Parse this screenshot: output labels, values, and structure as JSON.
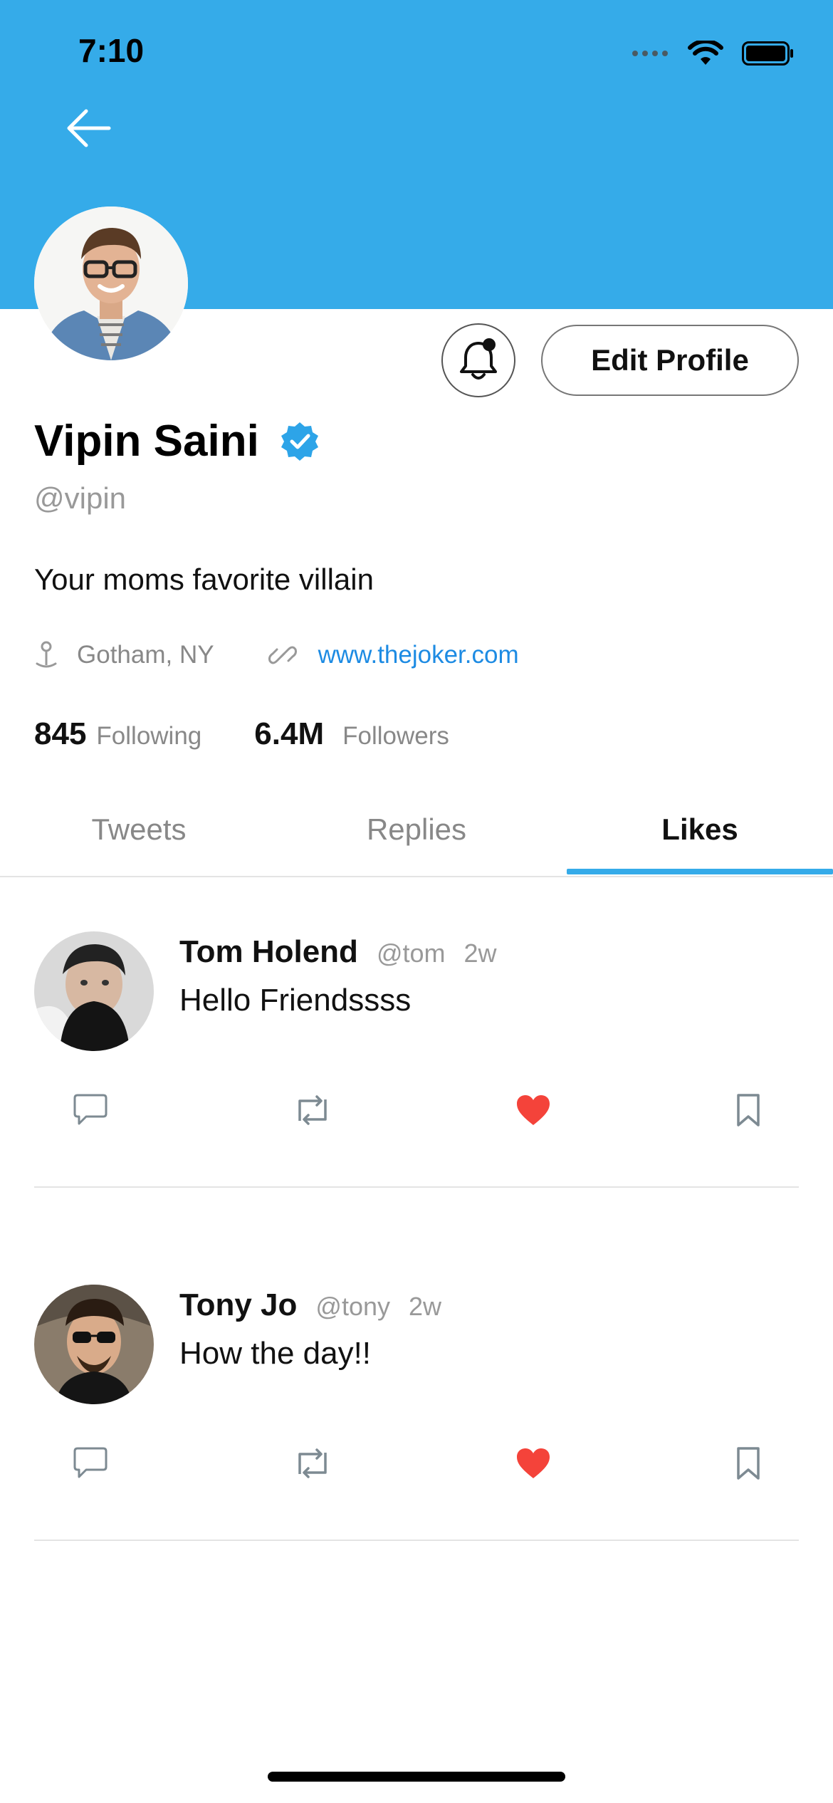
{
  "status_bar": {
    "time": "7:10"
  },
  "profile": {
    "name": "Vipin Saini",
    "handle": "@vipin",
    "bio": "Your moms favorite villain",
    "location": "Gotham, NY",
    "website": "www.thejoker.com",
    "following_count": "845",
    "following_label": "Following",
    "followers_count": "6.4M",
    "followers_label": "Followers",
    "edit_label": "Edit Profile"
  },
  "tabs": [
    {
      "label": "Tweets",
      "active": false
    },
    {
      "label": "Replies",
      "active": false
    },
    {
      "label": "Likes",
      "active": true
    }
  ],
  "tweets": [
    {
      "author": "Tom Holend",
      "username": "@tom",
      "time": "2w",
      "text": "Hello Friendssss",
      "liked": true
    },
    {
      "author": "Tony Jo",
      "username": "@tony",
      "time": "2w",
      "text": "How the day!!",
      "liked": true
    }
  ],
  "colors": {
    "accent": "#35abe9",
    "link": "#1d8be3",
    "like": "#f4433a",
    "verified": "#2da4e8"
  },
  "icons": [
    "back-arrow-icon",
    "bell-icon",
    "verified-icon",
    "location-icon",
    "link-icon",
    "comment-icon",
    "retweet-icon",
    "heart-icon",
    "bookmark-icon"
  ]
}
